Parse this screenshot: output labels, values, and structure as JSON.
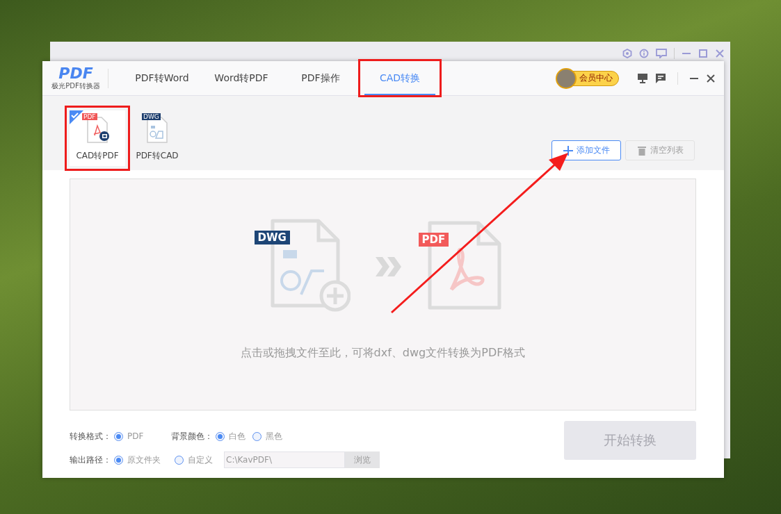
{
  "app": {
    "logo_text": "PDF",
    "logo_subtitle": "极光PDF转换器"
  },
  "tabs": [
    {
      "label": "PDF转Word",
      "selected": false,
      "highlighted": false
    },
    {
      "label": "Word转PDF",
      "selected": false,
      "highlighted": false
    },
    {
      "label": "PDF操作",
      "selected": false,
      "highlighted": false
    },
    {
      "label": "CAD转换",
      "selected": true,
      "highlighted": true
    }
  ],
  "member_button": {
    "label": "会员中心"
  },
  "modes": [
    {
      "label": "CAD转PDF",
      "kind": "cad-to-pdf",
      "badge": "PDF",
      "selected": true,
      "highlighted": true
    },
    {
      "label": "PDF转CAD",
      "kind": "pdf-to-cad",
      "badge": "DWG",
      "selected": false,
      "highlighted": false
    }
  ],
  "toolbar": {
    "add_button": {
      "label": "添加文件",
      "disabled": false,
      "pointed_at": true
    },
    "clear_button": {
      "label": "清空列表",
      "disabled": true
    }
  },
  "drop_zone": {
    "source_badge": "DWG",
    "target_badge": "PDF",
    "hint": "点击或拖拽文件至此，可将dxf、dwg文件转换为PDF格式"
  },
  "options": {
    "format": {
      "label": "转换格式：",
      "choices": [
        {
          "label": "PDF",
          "selected": true
        }
      ]
    },
    "background": {
      "label": "背景颜色：",
      "choices": [
        {
          "label": "白色",
          "selected": true
        },
        {
          "label": "黑色",
          "selected": false
        }
      ]
    },
    "output": {
      "label": "输出路径：",
      "choices": [
        {
          "label": "原文件夹",
          "selected": true
        },
        {
          "label": "自定义",
          "selected": false
        }
      ],
      "path": "C:\\KavPDF\\",
      "browse_button": {
        "label": "浏览",
        "disabled": true
      }
    }
  },
  "start_button": {
    "label": "开始转换",
    "disabled": true
  }
}
